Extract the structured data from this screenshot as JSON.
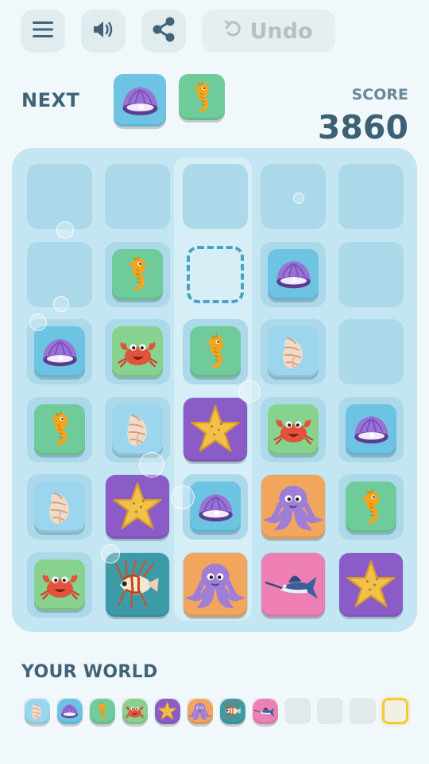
{
  "toolbar": {
    "menu_icon": "hamburger-icon",
    "sound_icon": "speaker-icon",
    "share_icon": "share-icon",
    "undo_label": "Undo",
    "undo_icon": "undo-arrow-icon"
  },
  "next": {
    "label": "NEXT",
    "pieces": [
      "clam",
      "seahorse"
    ]
  },
  "score": {
    "label": "SCORE",
    "value": "3860"
  },
  "board": {
    "rows": [
      [
        "empty",
        "empty",
        "empty",
        "empty",
        "empty"
      ],
      [
        "empty",
        "seahorse",
        "target",
        "clam",
        "empty"
      ],
      [
        "clam",
        "crab",
        "seahorse",
        "conch",
        "empty"
      ],
      [
        "seahorse",
        "conch",
        "starfish",
        "crab",
        "clam"
      ],
      [
        "conch",
        "starfish",
        "clam",
        "octopus",
        "seahorse"
      ],
      [
        "crab",
        "lionfish",
        "octopus",
        "marlin",
        "starfish"
      ]
    ],
    "highlighted_column": 2
  },
  "world": {
    "label": "YOUR WORLD",
    "discovered": [
      "conch",
      "clam",
      "seahorse",
      "crab",
      "starfish",
      "octopus",
      "lionfish",
      "marlin"
    ],
    "locked_slots": 3,
    "current_slot": "gold-highlight"
  },
  "colors": {
    "background": "#f0f8fb",
    "board": "#c4e6f2",
    "cell": "#acd9ea",
    "text": "#3f6377"
  }
}
